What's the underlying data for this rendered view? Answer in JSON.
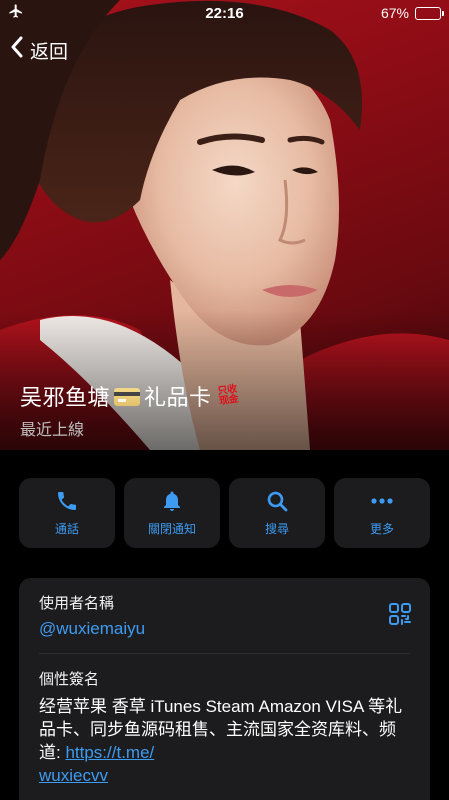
{
  "status_bar": {
    "time": "22:16",
    "battery_text": "67%",
    "battery_level": 0.67,
    "left_icon": "airplane-icon"
  },
  "nav": {
    "back_label": "返回",
    "back_icon": "chevron-left-icon"
  },
  "profile": {
    "name": "吴邪鱼塘",
    "name_suffix": "礼品卡",
    "card_icon": "credit-card-icon",
    "sticker_text": "只收现金",
    "last_seen": "最近上線",
    "photo_background": "#9b101a"
  },
  "actions": [
    {
      "label": "通話",
      "icon": "phone-icon"
    },
    {
      "label": "關閉通知",
      "icon": "bell-icon"
    },
    {
      "label": "搜尋",
      "icon": "search-icon"
    },
    {
      "label": "更多",
      "icon": "more-icon"
    }
  ],
  "info": {
    "username_label": "使用者名稱",
    "username": "@wuxiemaiyu",
    "qr_icon": "qr-code-icon",
    "bio_label": "個性簽名",
    "bio_text": "经营苹果 香草 iTunes Steam Amazon VISA 等礼品卡、同步鱼源码租售、主流国家全资库料、频道: ",
    "bio_link_line1": "https://t.me/",
    "bio_link_line2": "wuxiecvv"
  },
  "colors": {
    "accent": "#3d9bf2",
    "card_bg": "#1c1c1e",
    "page_bg": "#000000"
  }
}
